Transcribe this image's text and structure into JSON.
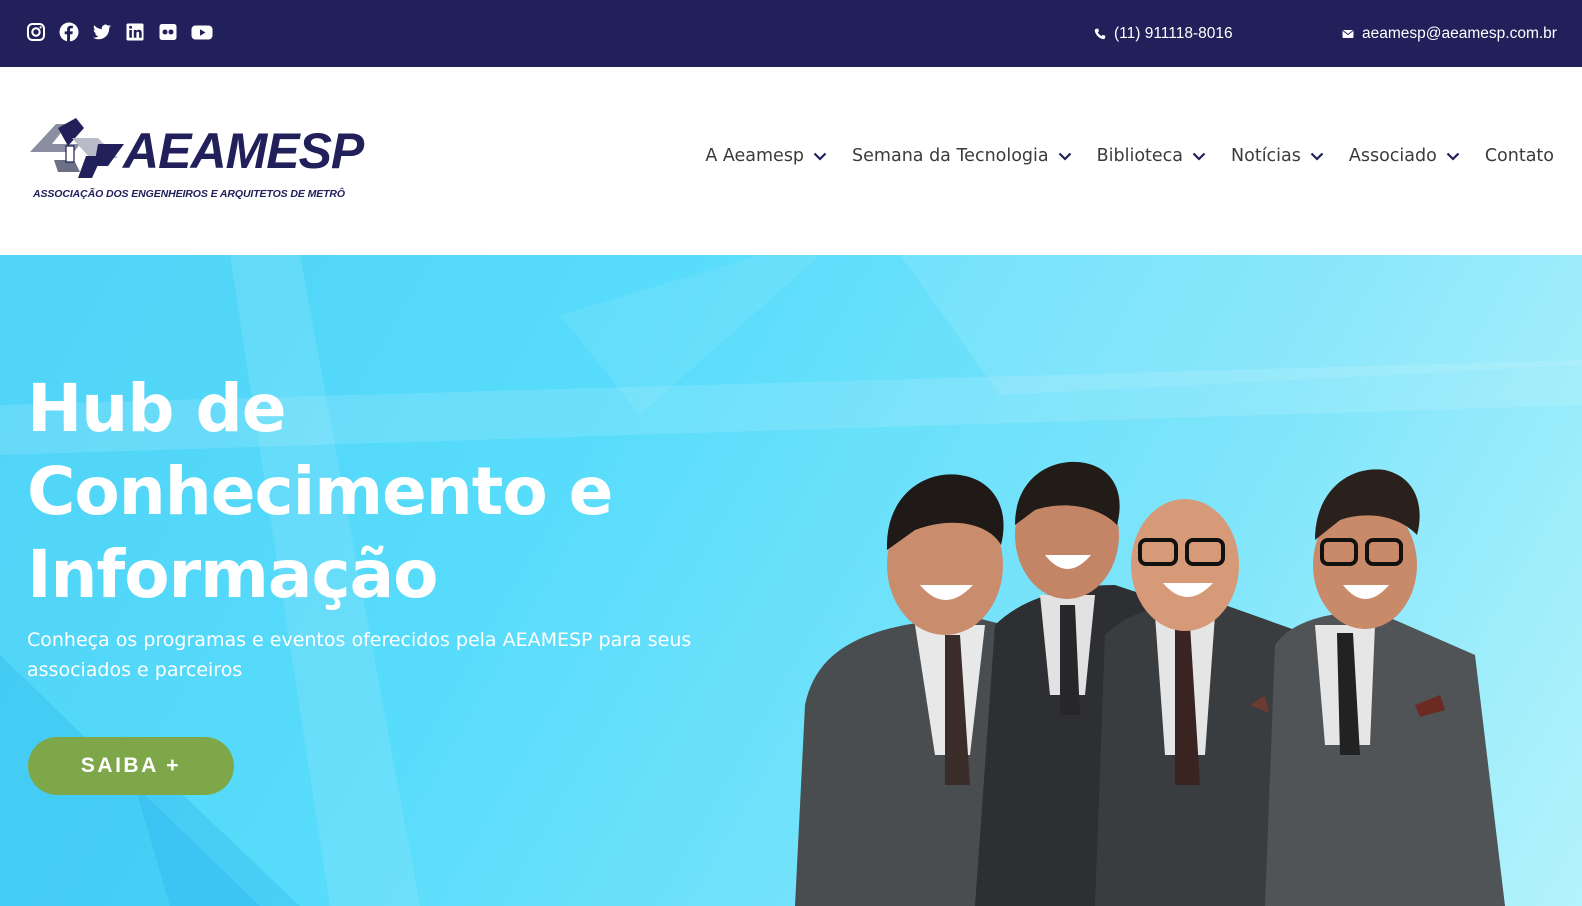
{
  "topbar": {
    "social": [
      "instagram-icon",
      "facebook-icon",
      "twitter-icon",
      "linkedin-icon",
      "flickr-icon",
      "youtube-icon"
    ],
    "phone": "(11) 911118-8016",
    "email": "aeamesp@aeamesp.com.br"
  },
  "logo": {
    "name": "AEAMESP",
    "subtitle": "ASSOCIAÇÃO DOS ENGENHEIROS E ARQUITETOS DE METRÔ"
  },
  "nav": {
    "items": [
      {
        "label": "A Aeamesp",
        "has_dropdown": true
      },
      {
        "label": "Semana da Tecnologia",
        "has_dropdown": true
      },
      {
        "label": "Biblioteca",
        "has_dropdown": true
      },
      {
        "label": "Notícias",
        "has_dropdown": true
      },
      {
        "label": "Associado",
        "has_dropdown": true
      },
      {
        "label": "Contato",
        "has_dropdown": false
      }
    ]
  },
  "hero": {
    "title_line1": "Hub de",
    "title_line2": "Conhecimento e",
    "title_line3": "Informação",
    "subtitle_line1": "Conheça os programas e eventos oferecidos pela AEAMESP para seus",
    "subtitle_line2": "associados e parceiros",
    "button_label": "SAIBA +"
  },
  "colors": {
    "navy": "#22205a",
    "button_green": "#7ea74a",
    "hero_cyan": "#58dcfb",
    "nav_text": "#3b3b3b"
  }
}
